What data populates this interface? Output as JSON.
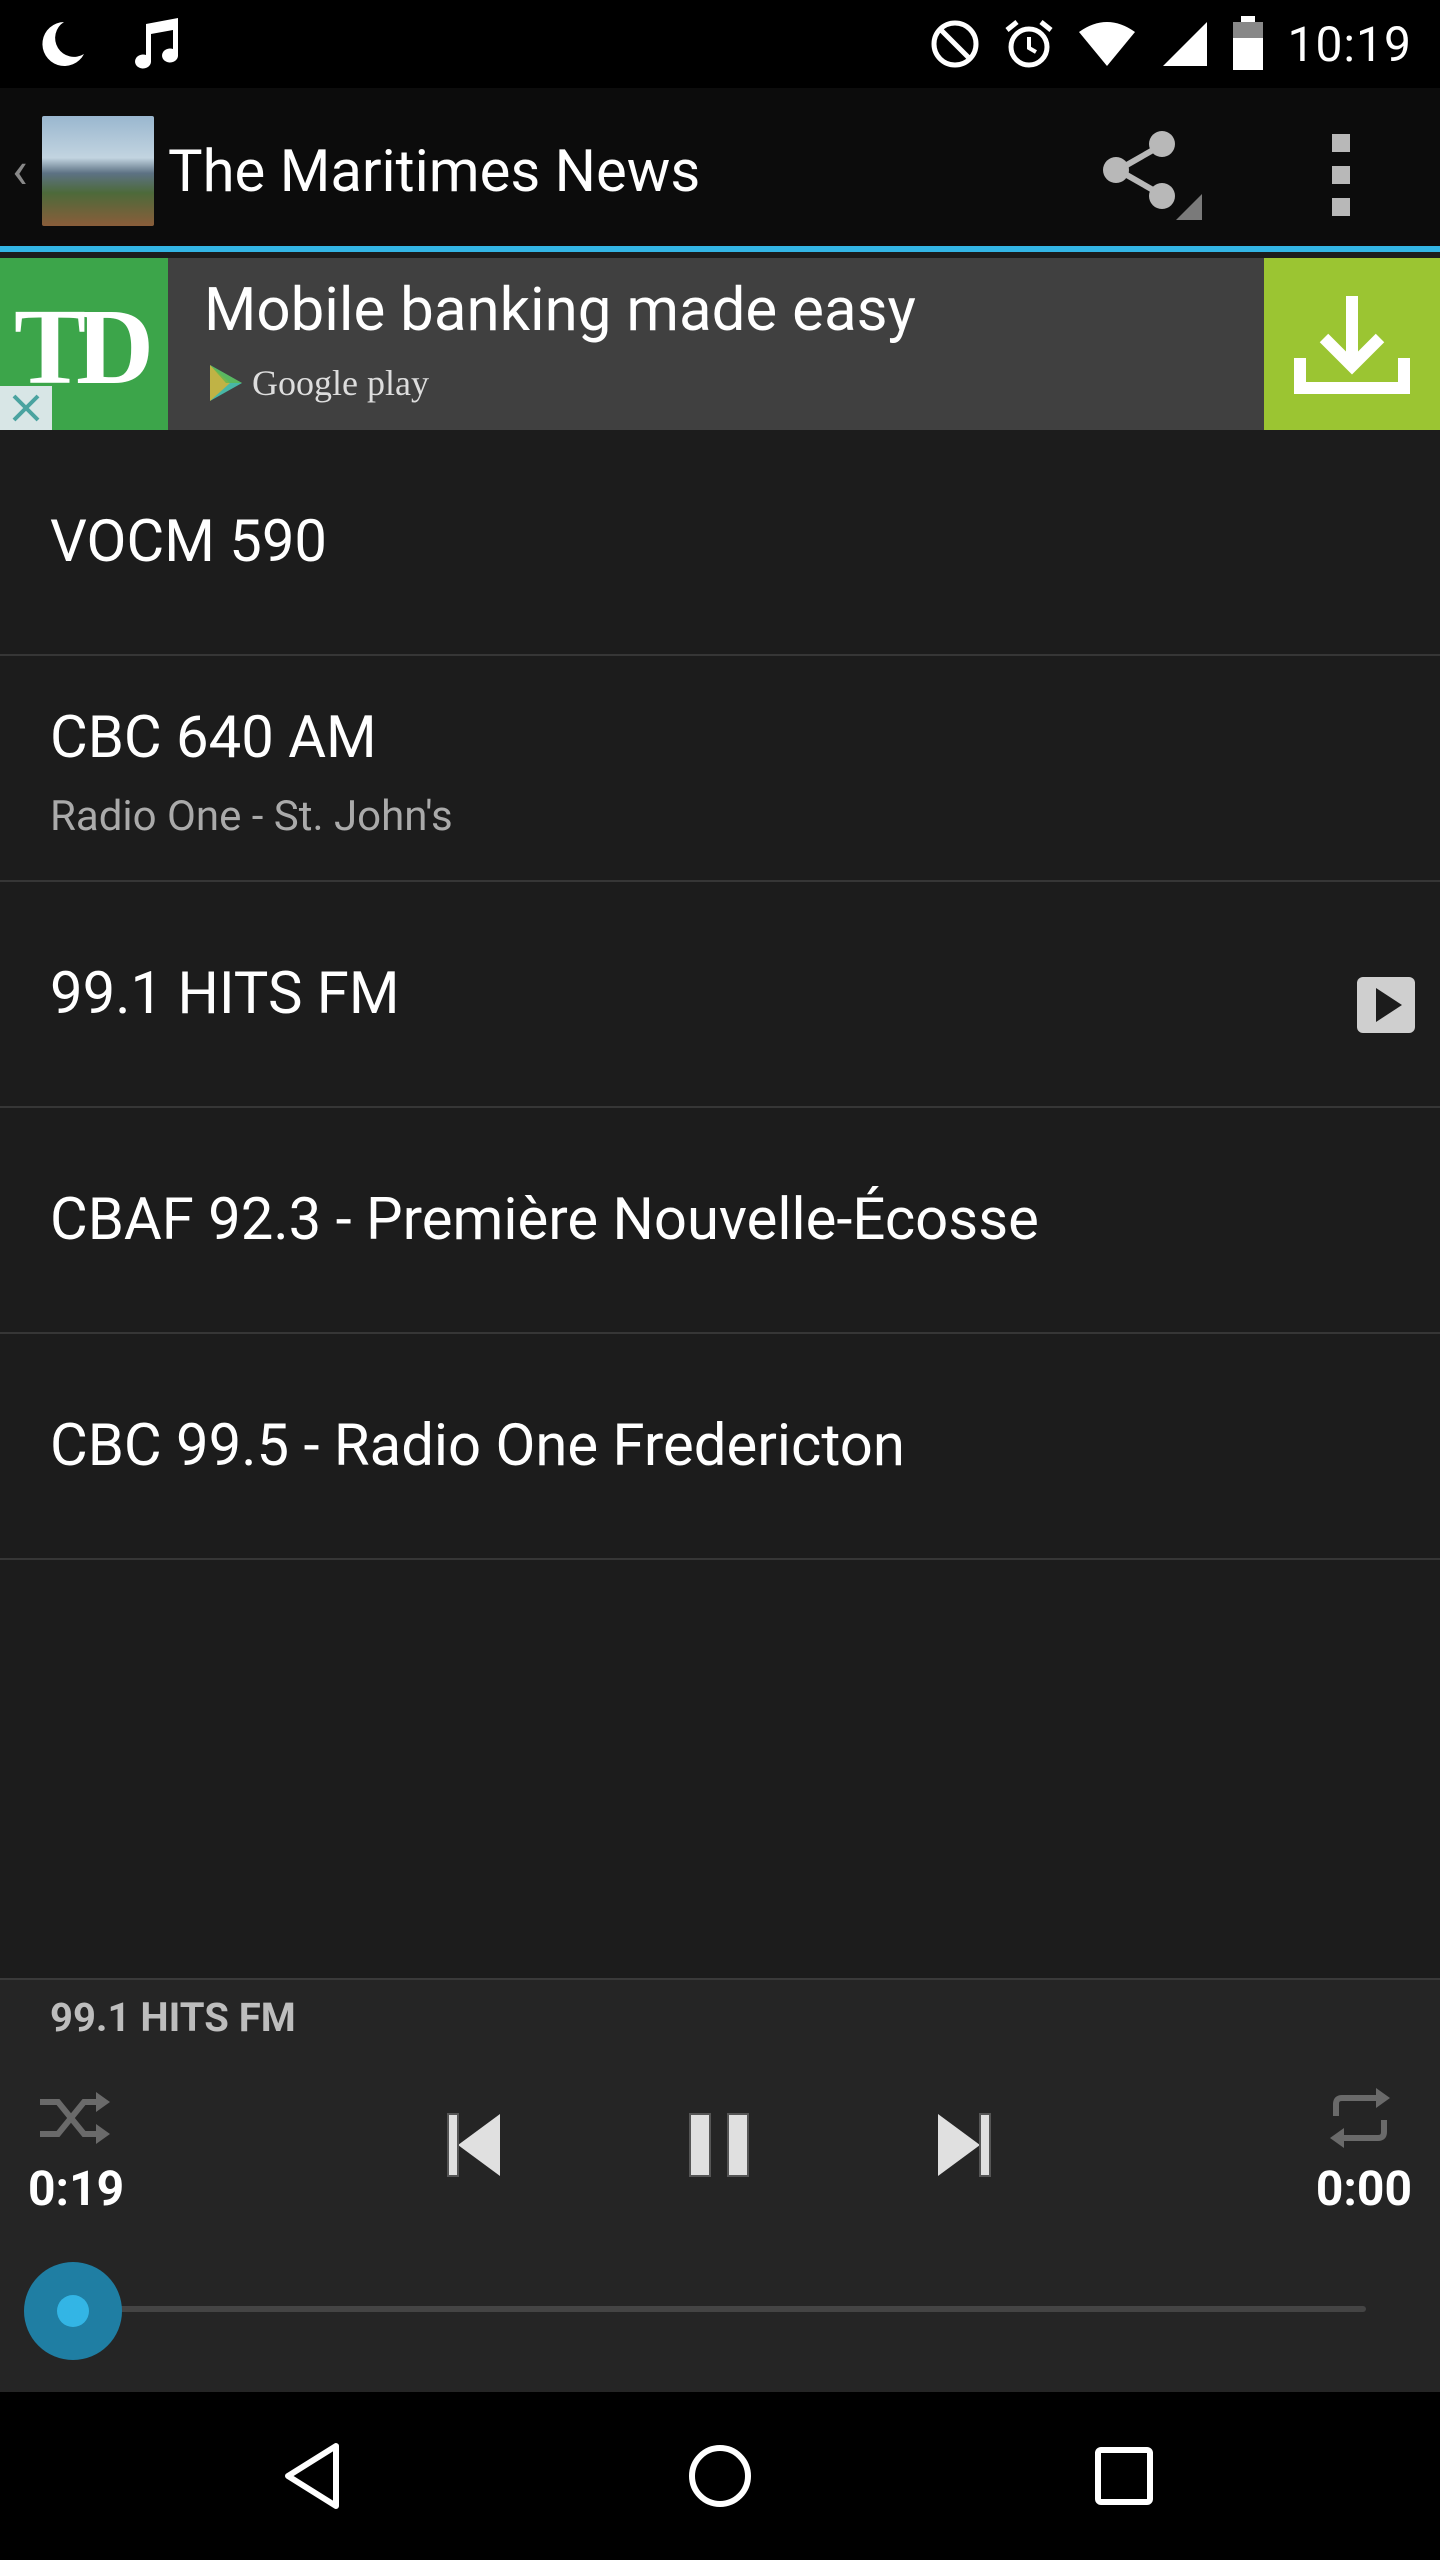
{
  "status_bar": {
    "time": "10:19",
    "left_icons": [
      "moon-icon",
      "music-note-icon"
    ],
    "right_icons": [
      "do-not-disturb-icon",
      "alarm-icon",
      "wifi-icon",
      "cellular-signal-icon",
      "battery-icon"
    ]
  },
  "action_bar": {
    "title": "The Maritimes News",
    "back_glyph": "‹",
    "accent_color": "#33b5e5"
  },
  "ad": {
    "brand": "TD",
    "headline": "Mobile banking made easy",
    "store": "Google play",
    "brand_color": "#3ca54a",
    "cta_color": "#9bc532"
  },
  "stations": [
    {
      "title": "VOCM 590",
      "subtitle": ""
    },
    {
      "title": "CBC 640 AM",
      "subtitle": "Radio One - St. John's"
    },
    {
      "title": "99.1 HITS FM",
      "subtitle": "",
      "playing": true
    },
    {
      "title": "CBAF 92.3 - Première Nouvelle-Écosse",
      "subtitle": ""
    },
    {
      "title": "CBC 99.5 - Radio One Fredericton",
      "subtitle": ""
    }
  ],
  "player": {
    "now_playing": "99.1 HITS FM",
    "elapsed": "0:19",
    "duration": "0:00",
    "progress": 0
  }
}
